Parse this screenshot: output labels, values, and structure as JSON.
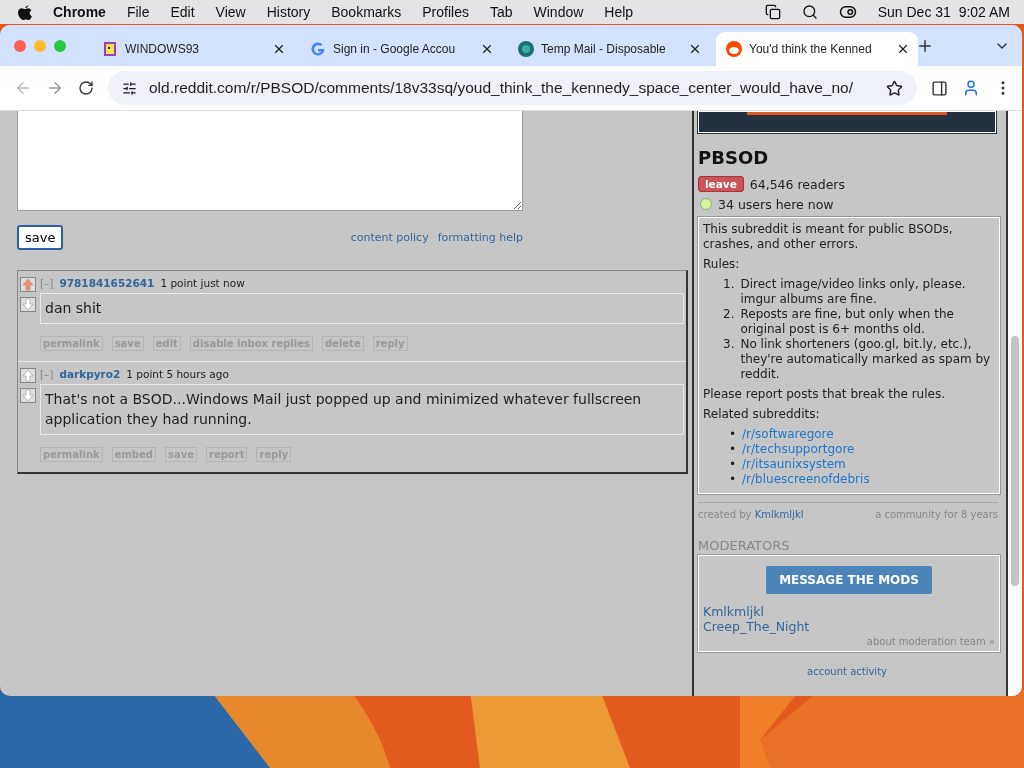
{
  "menu_bar": {
    "app": "Chrome",
    "items": [
      "File",
      "Edit",
      "View",
      "History",
      "Bookmarks",
      "Profiles",
      "Tab",
      "Window",
      "Help"
    ],
    "clock": "Sun Dec 31  9:02 AM"
  },
  "tabs": [
    {
      "title": "WINDOWS93",
      "kind": "windows93",
      "selected": false
    },
    {
      "title": "Sign in - Google Accou",
      "kind": "google",
      "selected": false
    },
    {
      "title": "Temp Mail - Disposable",
      "kind": "tempmail",
      "selected": false
    },
    {
      "title": "You'd think the Kenned",
      "kind": "reddit",
      "selected": true
    }
  ],
  "address_bar": {
    "url": "old.reddit.com/r/PBSOD/comments/18v33sq/youd_think_the_kennedy_space_center_would_have_no/"
  },
  "comment_form": {
    "save": "save",
    "links": [
      "content policy",
      "formatting help"
    ]
  },
  "comments": [
    {
      "collapse": "[–]",
      "author": "9781841652641",
      "meta": "1 point just now",
      "upvoted": true,
      "body": "dan shit",
      "actions": [
        "permalink",
        "save",
        "edit",
        "disable inbox replies",
        "delete",
        "reply"
      ]
    },
    {
      "collapse": "[–]",
      "author": "darkpyro2",
      "meta": "1 point 5 hours ago",
      "upvoted": false,
      "body": "That's not a BSOD...Windows Mail just popped up and minimized whatever fullscreen application they had running.",
      "actions": [
        "permalink",
        "embed",
        "save",
        "report",
        "reply"
      ]
    }
  ],
  "sidebar": {
    "title": "PBSOD",
    "leave": "leave",
    "readers": "64,546 readers",
    "online": "34 users here now",
    "description": "This subreddit is meant for public BSODs, crashes, and other errors.",
    "rules_label": "Rules:",
    "rules": [
      {
        "number": "1.",
        "text": "Direct image/video links only, please. imgur albums are fine."
      },
      {
        "number": "2.",
        "text": "Reposts are fine, but only when the original post is 6+ months old."
      },
      {
        "number": "3.",
        "text": "No link shorteners (goo.gl, bit.ly, etc.), they're automatically marked as spam by reddit."
      }
    ],
    "report_note": "Please report posts that break the rules.",
    "related_label": "Related subreddits:",
    "related": [
      {
        "bullet": "•",
        "name": "/r/softwaregore"
      },
      {
        "bullet": "•",
        "name": "/r/techsupportgore"
      },
      {
        "bullet": "•",
        "name": "/r/itsaunixsystem"
      },
      {
        "bullet": "•",
        "name": "/r/bluescreenofdebris"
      }
    ],
    "created_by": "created by",
    "creator": "Kmlkmljkl",
    "age": "a community for 8 years",
    "moderators_heading": "MODERATORS",
    "message_button": "MESSAGE THE MODS",
    "moderators": [
      "Kmlkmljkl",
      "Creep_The_Night"
    ],
    "about_team": "about moderation team »",
    "account_activity": "account activity"
  }
}
